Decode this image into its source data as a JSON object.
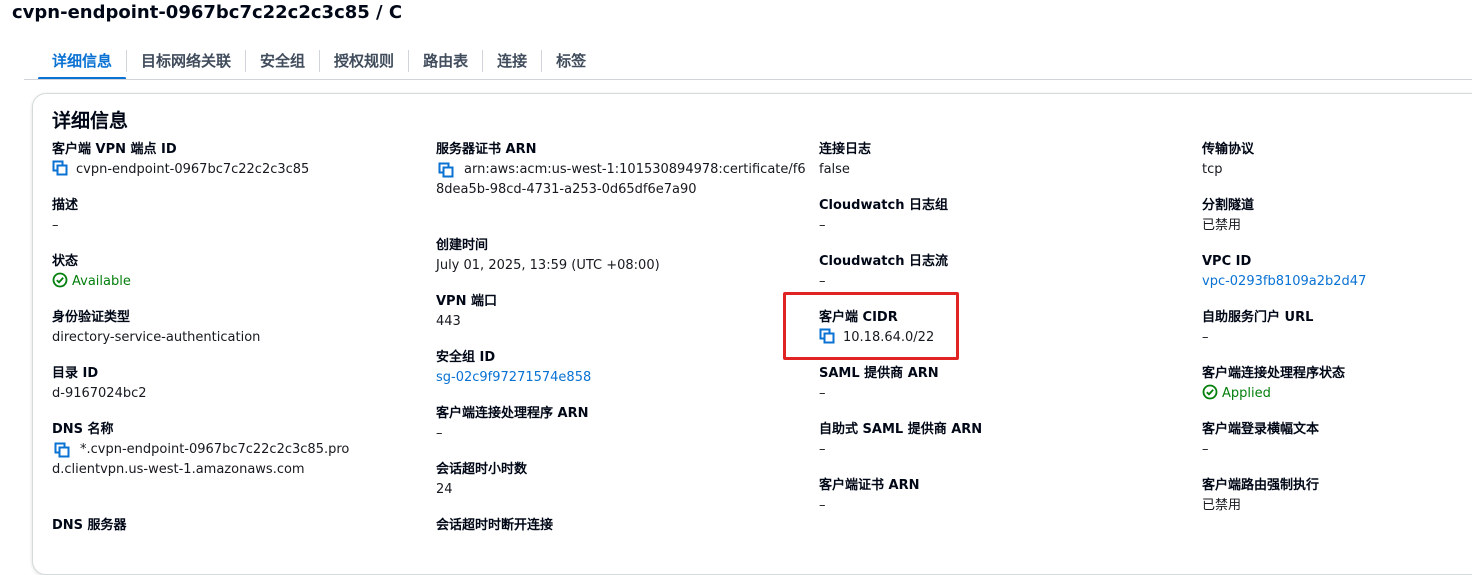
{
  "header": {
    "title": "cvpn-endpoint-0967bc7c22c2c3c85 / C"
  },
  "tabs": [
    {
      "label": "详细信息"
    },
    {
      "label": "目标网络关联"
    },
    {
      "label": "安全组"
    },
    {
      "label": "授权规则"
    },
    {
      "label": "路由表"
    },
    {
      "label": "连接"
    },
    {
      "label": "标签"
    }
  ],
  "panel": {
    "title": "详细信息"
  },
  "col1": {
    "endpoint_id": {
      "label": "客户端 VPN 端点 ID",
      "value": "cvpn-endpoint-0967bc7c22c2c3c85"
    },
    "description": {
      "label": "描述",
      "value": "–"
    },
    "state": {
      "label": "状态",
      "value": "Available"
    },
    "auth_type": {
      "label": "身份验证类型",
      "value": "directory-service-authentication"
    },
    "directory_id": {
      "label": "目录 ID",
      "value": "d-9167024bc2"
    },
    "dns_name": {
      "label": "DNS 名称",
      "value": "*.cvpn-endpoint-0967bc7c22c2c3c85.prod.clientvpn.us-west-1.amazonaws.com"
    },
    "dns_servers": {
      "label": "DNS 服务器"
    }
  },
  "col2": {
    "server_cert": {
      "label": "服务器证书 ARN",
      "value": "arn:aws:acm:us-west-1:101530894978:certificate/f68dea5b-98cd-4731-a253-0d65df6e7a90"
    },
    "created": {
      "label": "创建时间",
      "value": "July 01, 2025, 13:59 (UTC +08:00)"
    },
    "vpn_port": {
      "label": "VPN 端口",
      "value": "443"
    },
    "sg_id": {
      "label": "安全组 ID",
      "value": "sg-02c9f97271574e858"
    },
    "handler_arn": {
      "label": "客户端连接处理程序 ARN",
      "value": "–"
    },
    "timeout_hours": {
      "label": "会话超时小时数",
      "value": "24"
    },
    "timeout_disconnect": {
      "label": "会话超时时断开连接"
    }
  },
  "col3": {
    "conn_log": {
      "label": "连接日志",
      "value": "false"
    },
    "cw_group": {
      "label": "Cloudwatch 日志组",
      "value": "–"
    },
    "cw_stream": {
      "label": "Cloudwatch 日志流",
      "value": "–"
    },
    "client_cidr": {
      "label": "客户端 CIDR",
      "value": "10.18.64.0/22"
    },
    "saml_arn": {
      "label": "SAML 提供商 ARN",
      "value": "–"
    },
    "self_saml_arn": {
      "label": "自助式 SAML 提供商 ARN",
      "value": "–"
    },
    "client_cert_arn": {
      "label": "客户端证书 ARN",
      "value": "–"
    }
  },
  "col4": {
    "transport": {
      "label": "传输协议",
      "value": "tcp"
    },
    "split_tunnel": {
      "label": "分割隧道",
      "value": "已禁用"
    },
    "vpc_id": {
      "label": "VPC ID",
      "value": "vpc-0293fb8109a2b2d47"
    },
    "portal_url": {
      "label": "自助服务门户 URL",
      "value": "–"
    },
    "handler_status": {
      "label": "客户端连接处理程序状态",
      "value": "Applied"
    },
    "banner_text": {
      "label": "客户端登录横幅文本",
      "value": "–"
    },
    "route_enforce": {
      "label": "客户端路由强制执行",
      "value": "已禁用"
    }
  },
  "colors": {
    "link": "#0972d3",
    "success": "#037f0c",
    "highlight": "#e02424"
  },
  "icons": {
    "copy": "copy-icon",
    "status": "check-circle-icon"
  }
}
